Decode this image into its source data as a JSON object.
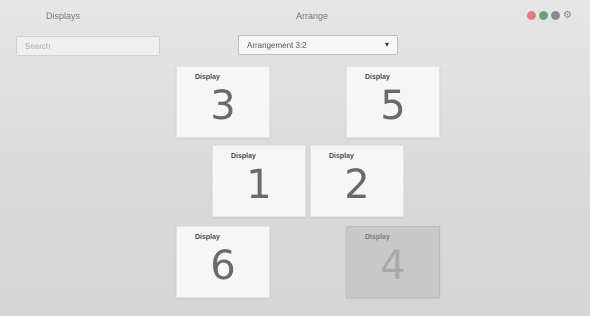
{
  "header": {
    "left_label": "Displays",
    "center_label": "Arrange",
    "search_placeholder": "Search",
    "select_value": "Arrangement 3:2"
  },
  "window_controls": {
    "items": [
      "close-dot",
      "maximize-dot",
      "minimize-dot",
      "settings-icon"
    ],
    "colors": {
      "close": "#e07c8a",
      "maximize": "#6fa06f",
      "minimize": "#8a8a8a"
    }
  },
  "tiles": [
    {
      "id": "3",
      "caption": "Display",
      "number": "3",
      "enabled": true
    },
    {
      "id": "5",
      "caption": "Display",
      "number": "5",
      "enabled": true
    },
    {
      "id": "1",
      "caption": "Display",
      "number": "1",
      "enabled": true
    },
    {
      "id": "2",
      "caption": "Display",
      "number": "2",
      "enabled": true
    },
    {
      "id": "6",
      "caption": "Display",
      "number": "6",
      "enabled": true
    },
    {
      "id": "4",
      "caption": "Display",
      "number": "4",
      "enabled": false
    }
  ]
}
